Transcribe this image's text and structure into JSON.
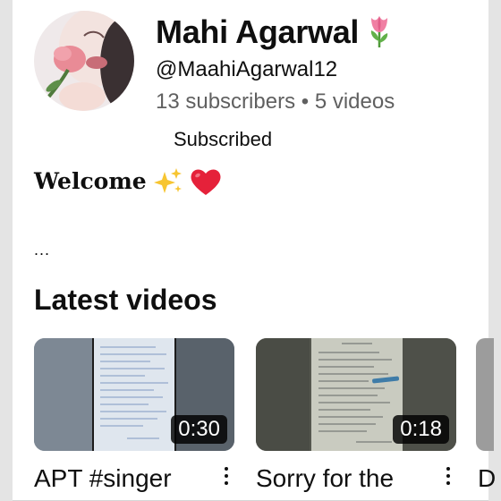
{
  "channel": {
    "name": "Mahi Agarwal",
    "name_emoji": "tulip-icon",
    "handle": "@MaahiAgarwal12",
    "subscribers": "13 subscribers",
    "separator": "•",
    "videos_count": "5 videos",
    "subscribe_state": "Subscribed"
  },
  "about": {
    "welcome_text": "Welcome",
    "emojis": [
      "sparkles-icon",
      "red-heart-icon"
    ],
    "more": "..."
  },
  "latest": {
    "title": "Latest videos",
    "videos": [
      {
        "duration": "0:30",
        "title": "APT #singer"
      },
      {
        "duration": "0:18",
        "title": "Sorry for the"
      },
      {
        "duration": "",
        "title": "D"
      }
    ]
  },
  "colors": {
    "text": "#0f0f0f",
    "secondary_text": "#606060",
    "page_background": "#ffffff",
    "duration_badge": "#000000"
  }
}
